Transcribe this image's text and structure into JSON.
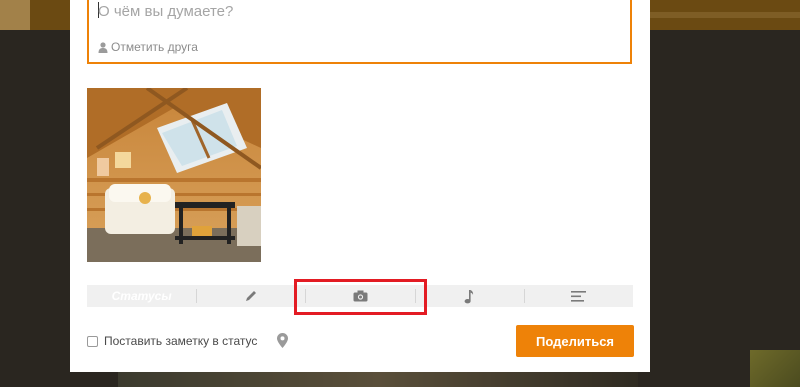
{
  "composer": {
    "placeholder": "О чём вы думаете?",
    "tag_friend_label": "Отметить друга"
  },
  "toolbar": {
    "items": [
      {
        "id": "statuses",
        "label": "Статусы"
      },
      {
        "id": "text",
        "icon": "pencil-icon"
      },
      {
        "id": "photo",
        "icon": "camera-icon",
        "highlighted": true
      },
      {
        "id": "music",
        "icon": "music-note-icon"
      },
      {
        "id": "poll",
        "icon": "align-left-icon"
      }
    ]
  },
  "footer": {
    "status_note_label": "Поставить заметку в статус",
    "status_note_checked": false,
    "location_icon": "map-pin-icon",
    "share_label": "Поделиться"
  },
  "colors": {
    "accent": "#ee8208",
    "highlight_border": "#e31b23"
  }
}
